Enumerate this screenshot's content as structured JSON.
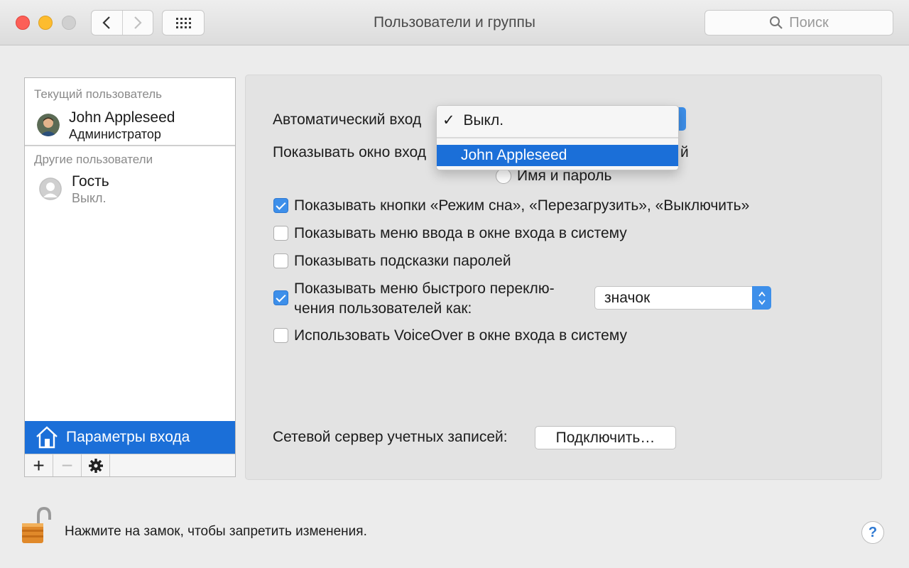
{
  "window": {
    "title": "Пользователи и группы"
  },
  "search": {
    "placeholder": "Поиск"
  },
  "sidebar": {
    "current_user_header": "Текущий пользователь",
    "current_user": {
      "name": "John Appleseed",
      "role": "Администратор"
    },
    "other_users_header": "Другие пользователи",
    "other_users": [
      {
        "name": "Гость",
        "status": "Выкл."
      }
    ],
    "login_options_label": "Параметры входа",
    "toolbar": {
      "add": "+",
      "remove": "−"
    }
  },
  "login_options": {
    "auto_login_label": "Автоматический вход",
    "auto_login_menu": {
      "checked_item": "Выкл.",
      "highlighted_item": "John Appleseed",
      "checkmark": "✓"
    },
    "show_window_label_visible": "Показывать окно вход",
    "show_window_label_tail": "й",
    "name_password_option": "Имя и пароль",
    "checkboxes": [
      {
        "label": "Показывать кнопки «Режим сна», «Перезагрузить», «Выключить»",
        "checked": true
      },
      {
        "label": "Показывать меню ввода в окне входа в систему",
        "checked": false
      },
      {
        "label": "Показывать подсказки паролей",
        "checked": false
      },
      {
        "label_line1": "Показывать меню быстрого переклю-",
        "label_line2": "чения пользователей как:",
        "checked": true
      },
      {
        "label": "Использовать VoiceOver в окне входа в систему",
        "checked": false
      }
    ],
    "fast_switch_value": "значок",
    "network_server_label": "Сетевой сервер учетных записей:",
    "connect_button": "Подключить…"
  },
  "footer": {
    "lock_text": "Нажмите на замок, чтобы запретить изменения.",
    "help": "?"
  },
  "colors": {
    "accent": "#1b6fd8",
    "checkbox_on": "#3d8fea"
  }
}
